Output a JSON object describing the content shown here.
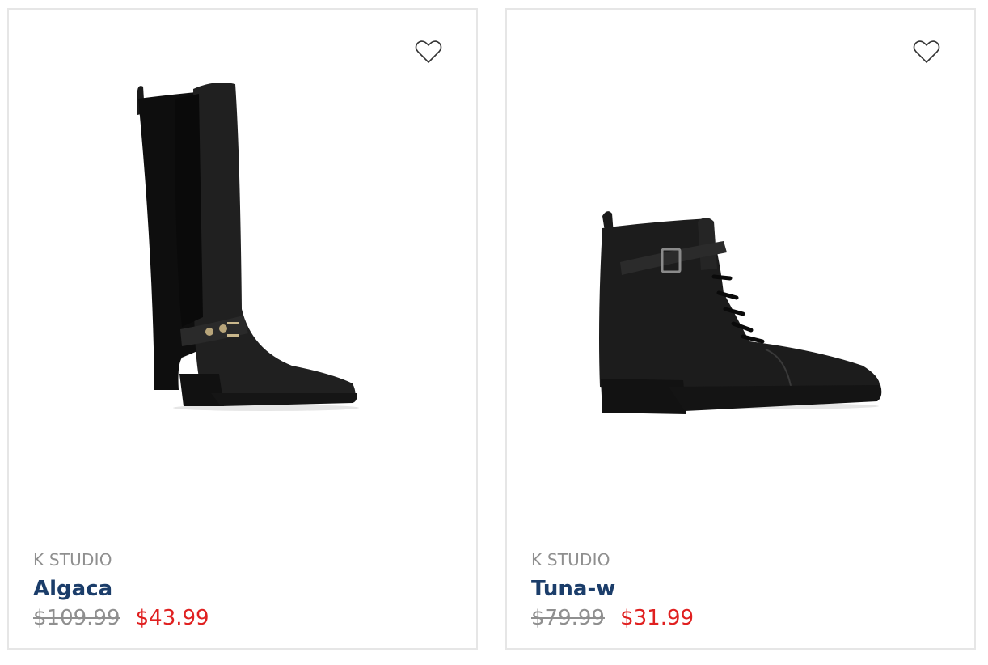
{
  "products": [
    {
      "brand": "K STUDIO",
      "name": "Algaca",
      "original_price": "$109.99",
      "sale_price": "$43.99",
      "image_icon": "tall-riding-boot-image",
      "wishlist_icon": "heart-outline-icon"
    },
    {
      "brand": "K STUDIO",
      "name": "Tuna-w",
      "original_price": "$79.99",
      "sale_price": "$31.99",
      "image_icon": "lace-up-ankle-boot-image",
      "wishlist_icon": "heart-outline-icon"
    }
  ],
  "colors": {
    "product_name": "#1b3d6a",
    "sale_price": "#e02020",
    "muted_text": "#8f8f8f",
    "card_border": "#e6e6e6"
  }
}
